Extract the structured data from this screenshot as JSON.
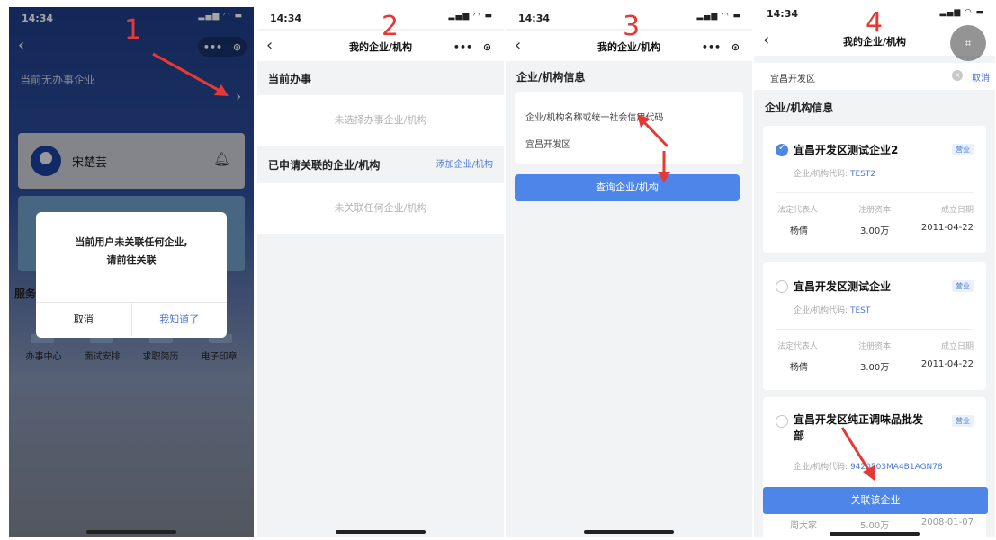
{
  "status": {
    "time": "14:34"
  },
  "annotations": {
    "step1": "1",
    "step2": "2",
    "step3": "3",
    "step4": "4"
  },
  "colors": {
    "accent": "#4d86e8",
    "arrow": "#e53935"
  },
  "screen1": {
    "back_icon": "chevron-left-icon",
    "capsule": {
      "more": "•••",
      "close": "⊙"
    },
    "no_business": "当前无办事企业",
    "user_name": "宋楚芸",
    "services_label": "服务",
    "services": [
      "办事中心",
      "面试安排",
      "求职简历",
      "电子印章"
    ],
    "dialog": {
      "line1": "当前用户未关联任何企业,",
      "line2": "请前往关联",
      "cancel": "取消",
      "ok": "我知道了"
    }
  },
  "screen2": {
    "title": "我的企业/机构",
    "current_section": "当前办事",
    "current_empty": "未选择办事企业/机构",
    "linked_section": "已申请关联的企业/机构",
    "add_link": "添加企业/机构",
    "linked_empty": "未关联任何企业/机构"
  },
  "screen3": {
    "title": "我的企业/机构",
    "section": "企业/机构信息",
    "placeholder": "企业/机构名称或统一社会信用代码",
    "value": "宜昌开发区",
    "query_button": "查询企业/机构"
  },
  "screen4": {
    "title": "我的企业/机构",
    "search_value": "宜昌开发区",
    "cancel": "取消",
    "section": "企业/机构信息",
    "labels": {
      "code": "企业/机构代码:",
      "rep": "法定代表人",
      "capital": "注册资本",
      "date": "成立日期"
    },
    "companies": [
      {
        "name": "宜昌开发区测试企业2",
        "status": "营业",
        "code": "TEST2",
        "rep": "杨倩",
        "capital": "3.00万",
        "date": "2011-04-22",
        "checked": true
      },
      {
        "name": "宜昌开发区测试企业",
        "status": "营业",
        "code": "TEST",
        "rep": "杨倩",
        "capital": "3.00万",
        "date": "2011-04-22",
        "checked": false
      },
      {
        "name_line1": "宜昌开发区纯正调味品批发",
        "name_line2": "部",
        "status": "营业",
        "code": "9420503MA4B1AGN78",
        "rep": "周大家",
        "capital": "5.00万",
        "date": "2008-01-07",
        "checked": false
      }
    ],
    "link_button": "关联该企业"
  }
}
